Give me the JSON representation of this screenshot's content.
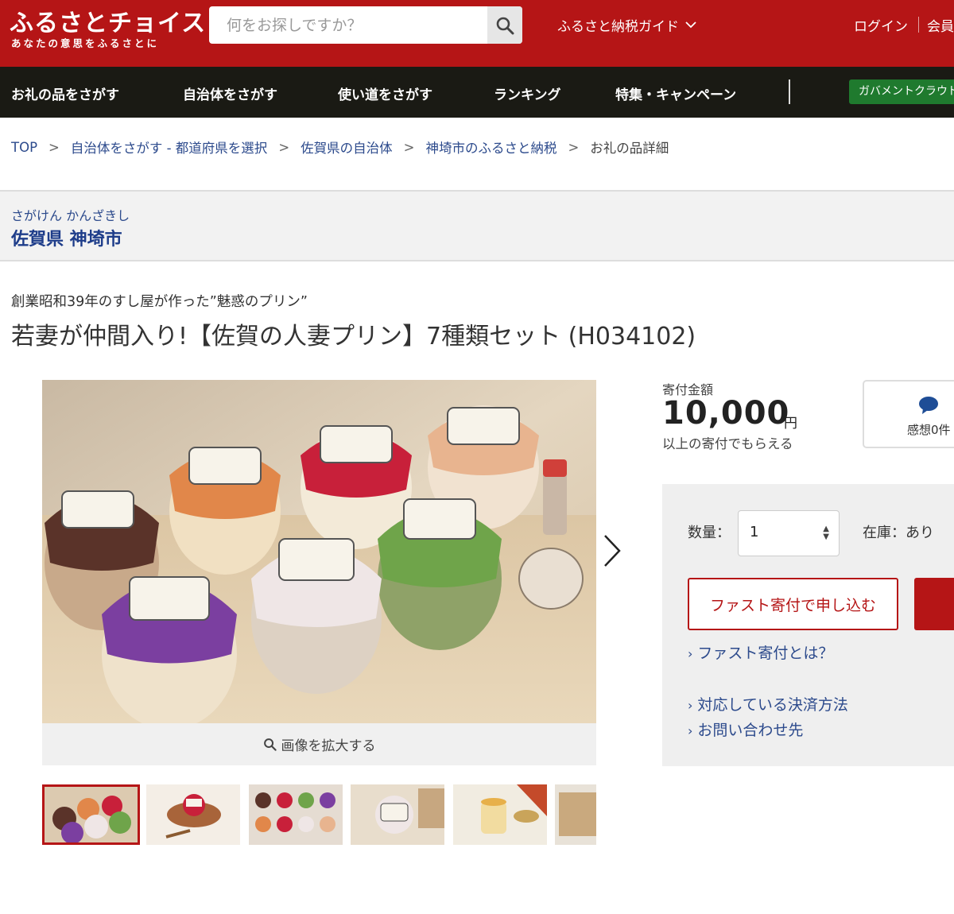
{
  "header": {
    "logo": "ふるさとチョイス",
    "tagline": "あなたの意思をふるさとに",
    "search_placeholder": "何をお探しですか？",
    "guide_label": "ふるさと納税ガイド",
    "login_label": "ログイン",
    "member_label": "会員"
  },
  "nav": {
    "items": [
      "お礼の品をさがす",
      "自治体をさがす",
      "使い道をさがす",
      "ランキング",
      "特集・キャンペーン"
    ],
    "gov_label": "ガバメントクラウドファンディング"
  },
  "breadcrumb": {
    "items": [
      "TOP",
      "自治体をさがす - 都道府県を選択",
      "佐賀県の自治体",
      "神埼市のふるさと納税"
    ],
    "current": "お礼の品詳細",
    "separator": ">"
  },
  "municipality": {
    "kana": "さがけん かんざきし",
    "name": "佐賀県 神埼市"
  },
  "product": {
    "catch": "創業昭和39年のすし屋が作った”魅惑のプリン”",
    "title": "若妻が仲間入り!【佐賀の人妻プリン】7種類セット (H034102)"
  },
  "gallery": {
    "zoom_label": "画像を拡大する"
  },
  "price": {
    "label": "寄付金額",
    "value": "10,000",
    "unit": "円",
    "note": "以上の寄付でもらえる"
  },
  "review": {
    "label": "感想0件"
  },
  "order": {
    "qty_label": "数量：",
    "qty_value": "1",
    "stock_label": "在庫：",
    "stock_value": "あり",
    "fast_button": "ファスト寄付で申し込む",
    "links": [
      "ファスト寄付とは？",
      "対応している決済方法",
      "お問い合わせ先"
    ]
  },
  "colors": {
    "brand": "#b51516",
    "nav_bg": "#1a1a14",
    "link": "#2c4a8c",
    "gov_green": "#1f7a2e"
  }
}
